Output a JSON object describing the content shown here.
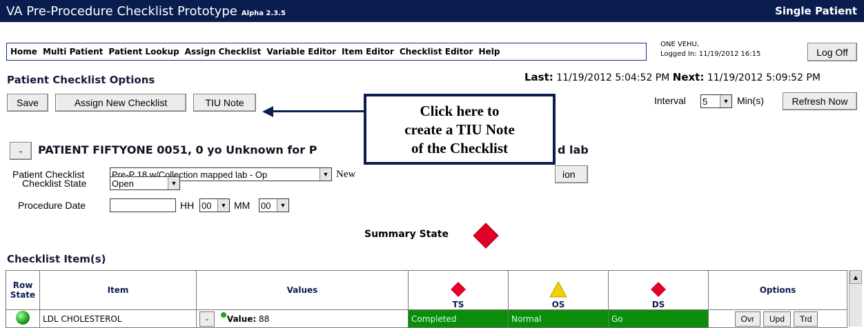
{
  "window": {
    "title": "VA Pre-Procedure Checklist Prototype",
    "version": "Alpha 2.3.5",
    "mode": "Single Patient"
  },
  "nav": {
    "items": [
      "Home",
      "Multi Patient",
      "Patient Lookup",
      "Assign Checklist",
      "Variable Editor",
      "Item Editor",
      "Checklist Editor",
      "Help"
    ]
  },
  "user": {
    "name": "ONE VEHU,",
    "logged_in": "Logged In: 11/19/2012 16:15",
    "logoff_label": "Log Off"
  },
  "options": {
    "heading": "Patient Checklist Options",
    "save_label": "Save",
    "assign_label": "Assign New Checklist",
    "tiu_label": "TIU Note"
  },
  "refresh": {
    "last_label": "Last:",
    "last_value": "11/19/2012 5:04:52 PM",
    "next_label": "Next:",
    "next_value": "11/19/2012 5:09:52 PM",
    "interval_label": "Interval",
    "interval_value": "5",
    "unit": "Min(s)",
    "refresh_label": "Refresh Now"
  },
  "patient": {
    "collapse": "-",
    "line_start": "PATIENT FIFTYONE 0051, 0 yo Unknown for P",
    "line_end": "d lab"
  },
  "form": {
    "checklist_label": "Patient Checklist",
    "checklist_value": "Pre-P 18 w/Collection mapped lab - Op",
    "new_label": "New",
    "hidden_button_tail": "ion",
    "state_label": "Checklist State",
    "state_value": "Open",
    "date_label": "Procedure Date",
    "hh_label": "HH",
    "hh_value": "00",
    "mm_label": "MM",
    "mm_value": "00"
  },
  "callout": {
    "lines": [
      "Click here to",
      "create a TIU Note",
      "of the Checklist"
    ]
  },
  "summary": {
    "label": "Summary State",
    "color": "#e0002a"
  },
  "items": {
    "heading": "Checklist Item(s)",
    "columns": {
      "row_state": "Row State",
      "item": "Item",
      "values": "Values",
      "ts": "TS",
      "os": "OS",
      "ds": "DS",
      "options": "Options"
    },
    "rows": [
      {
        "item": "LDL CHOLESTEROL",
        "collapse": "-",
        "value_label": "Value:",
        "value": "88",
        "ts": "Completed",
        "os": "Normal",
        "ds": "Go",
        "ovr": "Ovr",
        "upd": "Upd",
        "trd": "Trd"
      }
    ]
  },
  "colors": {
    "titlebar": "#0b1d4f",
    "status_green": "#0b8c0b",
    "alert_red": "#e0002a",
    "warn_yellow": "#f2d000"
  }
}
